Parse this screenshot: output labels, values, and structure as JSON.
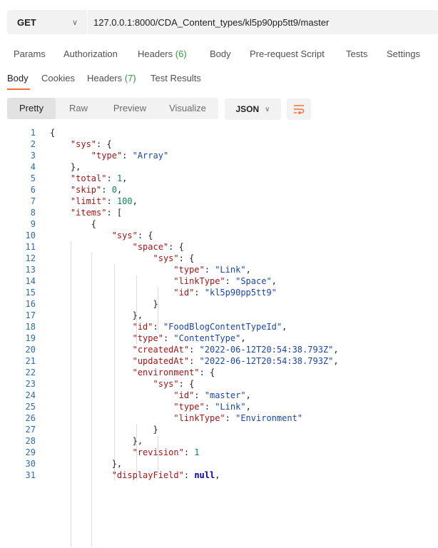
{
  "request": {
    "method": "GET",
    "url": "127.0.0.1:8000/CDA_Content_types/kl5p90pp5tt9/master"
  },
  "request_tabs": [
    {
      "label": "Params"
    },
    {
      "label": "Authorization"
    },
    {
      "label": "Headers",
      "count": "(6)"
    },
    {
      "label": "Body"
    },
    {
      "label": "Pre-request Script"
    },
    {
      "label": "Tests"
    },
    {
      "label": "Settings"
    }
  ],
  "response_tabs": [
    {
      "label": "Body"
    },
    {
      "label": "Cookies"
    },
    {
      "label": "Headers",
      "count": "(7)"
    },
    {
      "label": "Test Results"
    }
  ],
  "view_modes": [
    {
      "label": "Pretty"
    },
    {
      "label": "Raw"
    },
    {
      "label": "Preview"
    },
    {
      "label": "Visualize"
    }
  ],
  "format": "JSON",
  "colors": {
    "accent": "#ff6c37",
    "count": "#2e9e3a",
    "line_number": "#2b6cb0",
    "json_key": "#a31515",
    "json_string": "#1a46a8",
    "json_number": "#098658"
  },
  "code_lines": [
    {
      "n": "1",
      "t": [
        [
          "p",
          "{"
        ]
      ]
    },
    {
      "n": "2",
      "t": [
        [
          "p",
          "    "
        ],
        [
          "k",
          "\"sys\""
        ],
        [
          "p",
          ": {"
        ]
      ]
    },
    {
      "n": "3",
      "t": [
        [
          "p",
          "        "
        ],
        [
          "k",
          "\"type\""
        ],
        [
          "p",
          ": "
        ],
        [
          "s",
          "\"Array\""
        ]
      ]
    },
    {
      "n": "4",
      "t": [
        [
          "p",
          "    },"
        ]
      ]
    },
    {
      "n": "5",
      "t": [
        [
          "p",
          "    "
        ],
        [
          "k",
          "\"total\""
        ],
        [
          "p",
          ": "
        ],
        [
          "n",
          "1"
        ],
        [
          "p",
          ","
        ]
      ]
    },
    {
      "n": "6",
      "t": [
        [
          "p",
          "    "
        ],
        [
          "k",
          "\"skip\""
        ],
        [
          "p",
          ": "
        ],
        [
          "n",
          "0"
        ],
        [
          "p",
          ","
        ]
      ]
    },
    {
      "n": "7",
      "t": [
        [
          "p",
          "    "
        ],
        [
          "k",
          "\"limit\""
        ],
        [
          "p",
          ": "
        ],
        [
          "n",
          "100"
        ],
        [
          "p",
          ","
        ]
      ]
    },
    {
      "n": "8",
      "t": [
        [
          "p",
          "    "
        ],
        [
          "k",
          "\"items\""
        ],
        [
          "p",
          ": ["
        ]
      ]
    },
    {
      "n": "9",
      "t": [
        [
          "p",
          "        {"
        ]
      ]
    },
    {
      "n": "10",
      "t": [
        [
          "p",
          "            "
        ],
        [
          "k",
          "\"sys\""
        ],
        [
          "p",
          ": {"
        ]
      ]
    },
    {
      "n": "11",
      "t": [
        [
          "p",
          "                "
        ],
        [
          "k",
          "\"space\""
        ],
        [
          "p",
          ": {"
        ]
      ]
    },
    {
      "n": "12",
      "t": [
        [
          "p",
          "                    "
        ],
        [
          "k",
          "\"sys\""
        ],
        [
          "p",
          ": {"
        ]
      ]
    },
    {
      "n": "13",
      "t": [
        [
          "p",
          "                        "
        ],
        [
          "k",
          "\"type\""
        ],
        [
          "p",
          ": "
        ],
        [
          "s",
          "\"Link\""
        ],
        [
          "p",
          ","
        ]
      ]
    },
    {
      "n": "14",
      "t": [
        [
          "p",
          "                        "
        ],
        [
          "k",
          "\"linkType\""
        ],
        [
          "p",
          ": "
        ],
        [
          "s",
          "\"Space\""
        ],
        [
          "p",
          ","
        ]
      ]
    },
    {
      "n": "15",
      "t": [
        [
          "p",
          "                        "
        ],
        [
          "k",
          "\"id\""
        ],
        [
          "p",
          ": "
        ],
        [
          "s",
          "\"kl5p90pp5tt9\""
        ]
      ]
    },
    {
      "n": "16",
      "t": [
        [
          "p",
          "                    }"
        ]
      ]
    },
    {
      "n": "17",
      "t": [
        [
          "p",
          "                },"
        ]
      ]
    },
    {
      "n": "18",
      "t": [
        [
          "p",
          "                "
        ],
        [
          "k",
          "\"id\""
        ],
        [
          "p",
          ": "
        ],
        [
          "s",
          "\"FoodBlogContentTypeId\""
        ],
        [
          "p",
          ","
        ]
      ]
    },
    {
      "n": "19",
      "t": [
        [
          "p",
          "                "
        ],
        [
          "k",
          "\"type\""
        ],
        [
          "p",
          ": "
        ],
        [
          "s",
          "\"ContentType\""
        ],
        [
          "p",
          ","
        ]
      ]
    },
    {
      "n": "20",
      "t": [
        [
          "p",
          "                "
        ],
        [
          "k",
          "\"createdAt\""
        ],
        [
          "p",
          ": "
        ],
        [
          "s",
          "\"2022-06-12T20:54:38.793Z\""
        ],
        [
          "p",
          ","
        ]
      ]
    },
    {
      "n": "21",
      "t": [
        [
          "p",
          "                "
        ],
        [
          "k",
          "\"updatedAt\""
        ],
        [
          "p",
          ": "
        ],
        [
          "s",
          "\"2022-06-12T20:54:38.793Z\""
        ],
        [
          "p",
          ","
        ]
      ]
    },
    {
      "n": "22",
      "t": [
        [
          "p",
          "                "
        ],
        [
          "k",
          "\"environment\""
        ],
        [
          "p",
          ": {"
        ]
      ]
    },
    {
      "n": "23",
      "t": [
        [
          "p",
          "                    "
        ],
        [
          "k",
          "\"sys\""
        ],
        [
          "p",
          ": {"
        ]
      ]
    },
    {
      "n": "24",
      "t": [
        [
          "p",
          "                        "
        ],
        [
          "k",
          "\"id\""
        ],
        [
          "p",
          ": "
        ],
        [
          "s",
          "\"master\""
        ],
        [
          "p",
          ","
        ]
      ]
    },
    {
      "n": "25",
      "t": [
        [
          "p",
          "                        "
        ],
        [
          "k",
          "\"type\""
        ],
        [
          "p",
          ": "
        ],
        [
          "s",
          "\"Link\""
        ],
        [
          "p",
          ","
        ]
      ]
    },
    {
      "n": "26",
      "t": [
        [
          "p",
          "                        "
        ],
        [
          "k",
          "\"linkType\""
        ],
        [
          "p",
          ": "
        ],
        [
          "s",
          "\"Environment\""
        ]
      ]
    },
    {
      "n": "27",
      "t": [
        [
          "p",
          "                    }"
        ]
      ]
    },
    {
      "n": "28",
      "t": [
        [
          "p",
          "                },"
        ]
      ]
    },
    {
      "n": "29",
      "t": [
        [
          "p",
          "                "
        ],
        [
          "k",
          "\"revision\""
        ],
        [
          "p",
          ": "
        ],
        [
          "n",
          "1"
        ]
      ]
    },
    {
      "n": "30",
      "t": [
        [
          "p",
          "            },"
        ]
      ]
    },
    {
      "n": "31",
      "t": [
        [
          "p",
          "            "
        ],
        [
          "k",
          "\"displayField\""
        ],
        [
          "p",
          ": "
        ],
        [
          "kw",
          "null"
        ],
        [
          "p",
          ","
        ]
      ]
    }
  ]
}
